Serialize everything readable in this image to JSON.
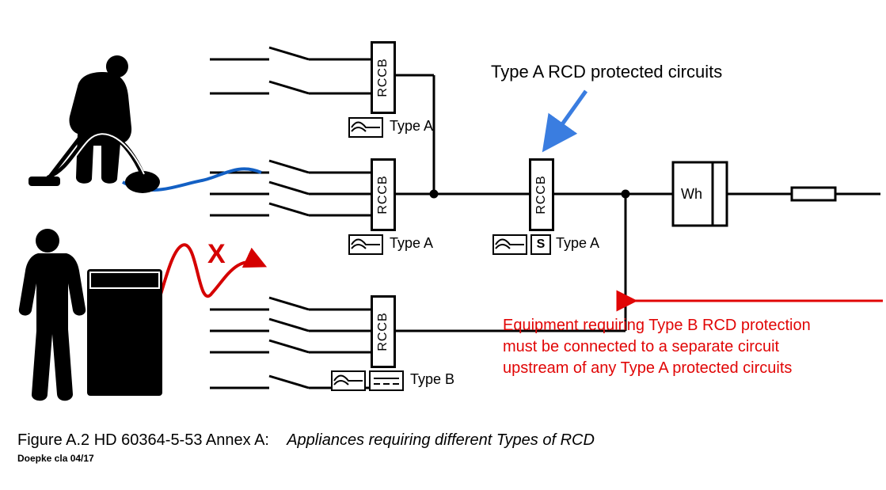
{
  "title_blue": "Type A RCD protected circuits",
  "note_red_l1": "Equipment requiring Type B RCD protection",
  "note_red_l2": "must be connected to a separate circuit",
  "note_red_l3": "upstream of any Type A protected circuits",
  "rccb_label": "RCCB",
  "type_a": "Type A",
  "type_b": "Type B",
  "meter_label": "Wh",
  "s_label": "S",
  "red_x": "X",
  "caption_prefix": "Figure A.2 HD 60364-5-53 Annex A:",
  "caption_italic": "Appliances requiring different Types of RCD",
  "credit": "Doepke cla 04/17",
  "diagram": {
    "rccb_devices": [
      {
        "id": "rccb-1",
        "type": "Type A",
        "lines_in": 2
      },
      {
        "id": "rccb-2",
        "type": "Type A",
        "lines_in": 3
      },
      {
        "id": "rccb-3-main",
        "type": "Type A",
        "selective": true
      },
      {
        "id": "rccb-4",
        "type": "Type B",
        "lines_in": 3
      }
    ],
    "meter": "Wh",
    "fuse": true,
    "annotations": {
      "blue_arrow_target": "rccb-3-main",
      "red_arrow_target": "type-b-branch",
      "wrong_connection": {
        "from": "type-b-load",
        "to": "rccb-2-line",
        "mark": "X"
      }
    }
  }
}
